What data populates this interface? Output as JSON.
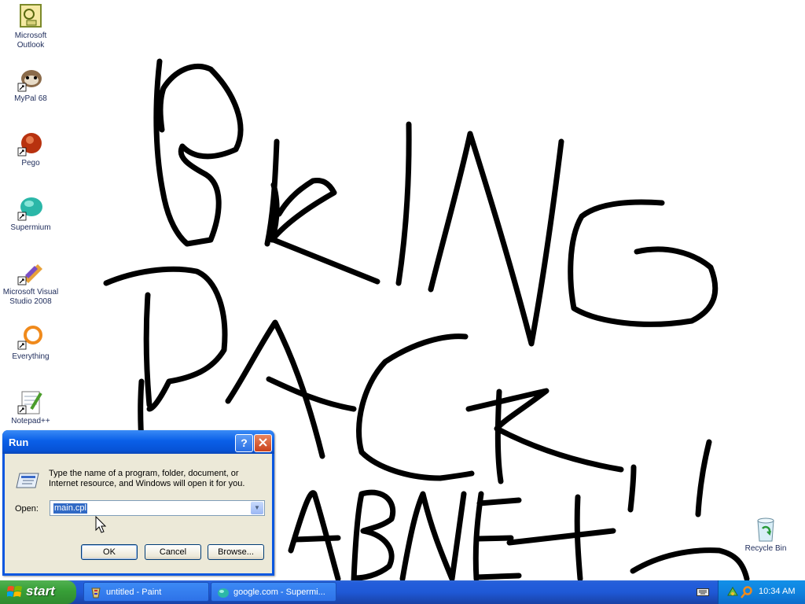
{
  "desktop": {
    "icons": [
      {
        "label": "Microsoft Outlook",
        "icon": "outlook-icon"
      },
      {
        "label": "MyPal 68",
        "icon": "mypal-icon"
      },
      {
        "label": "Pego",
        "icon": "pego-icon"
      },
      {
        "label": "Supermium",
        "icon": "supermium-icon"
      },
      {
        "label": "Microsoft Visual Studio 2008",
        "icon": "visual-studio-icon"
      },
      {
        "label": "Everything",
        "icon": "everything-icon"
      },
      {
        "label": "Notepad++",
        "icon": "notepadpp-icon"
      }
    ],
    "recycle_bin_label": "Recycle Bin"
  },
  "run_dialog": {
    "title": "Run",
    "description": "Type the name of a program, folder, document, or Internet resource, and Windows will open it for you.",
    "open_label": "Open:",
    "open_value": "main.cpl",
    "ok_label": "OK",
    "cancel_label": "Cancel",
    "browse_label": "Browse..."
  },
  "taskbar": {
    "start_label": "start",
    "tasks": [
      {
        "label": "untitled - Paint",
        "icon": "paint-icon"
      },
      {
        "label": "google.com - Supermi...",
        "icon": "supermium-icon"
      }
    ],
    "clock": "10:34 AM"
  },
  "colors": {
    "taskbar_blue": "#245edb",
    "start_green": "#379f37",
    "tray_blue": "#0f83df",
    "dialog_face": "#ece9d8",
    "selection": "#316ac5"
  }
}
